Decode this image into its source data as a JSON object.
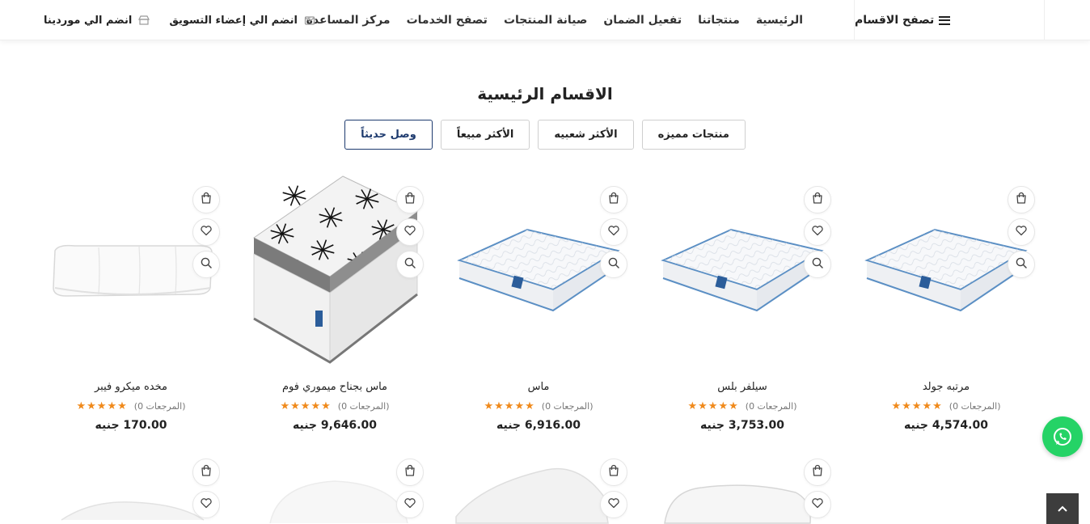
{
  "nav": {
    "categories_label": "تصفح الاقسام",
    "links": [
      "الرئيسية",
      "منتجاتنا",
      "تفعيل الضمان",
      "صيانة المنتجات",
      "تصفح الخدمات",
      "مركز المساعدة"
    ],
    "join_marketing": "انضم الي إعضاء التسويق",
    "join_suppliers": "انضم الي موردينا"
  },
  "section": {
    "title": "الاقسام الرئيسية",
    "tabs": [
      "منتجات مميزه",
      "الأكثر شعبيه",
      "الأكثر مبيعاً",
      "وصل حديثاً"
    ],
    "active_tab": "وصل حديثاً"
  },
  "products": [
    {
      "name": "مرتبه جولد",
      "reviews": "(المرجعات 0)",
      "rating": 5,
      "price": "4,574.00 جنيه",
      "image": "mattress"
    },
    {
      "name": "سيلفر بلس",
      "reviews": "(المرجعات 0)",
      "rating": 5,
      "price": "3,753.00 جنيه",
      "image": "mattress"
    },
    {
      "name": "ماس",
      "reviews": "(المرجعات 0)",
      "rating": 5,
      "price": "6,916.00 جنيه",
      "image": "mattress"
    },
    {
      "name": "ماس بجناح ميموري فوم",
      "reviews": "(المرجعات 0)",
      "rating": 5,
      "price": "9,646.00 جنيه",
      "image": "pillow-top-mattress"
    },
    {
      "name": "مخده ميكرو فيبر",
      "reviews": "(المرجعات 0)",
      "rating": 5,
      "price": "170.00 جنيه",
      "image": "long-pillow"
    }
  ],
  "icons": {
    "cart": "shopping-bag-icon",
    "wishlist": "heart-icon",
    "quickview": "search-icon",
    "whatsapp": "whatsapp-icon",
    "scroll_top": "chevron-up-icon"
  },
  "colors": {
    "active_tab": "#1d3a6e",
    "stars": "#f08a1c",
    "whatsapp": "#25d366",
    "mattress_piping": "#5b8fc4"
  }
}
